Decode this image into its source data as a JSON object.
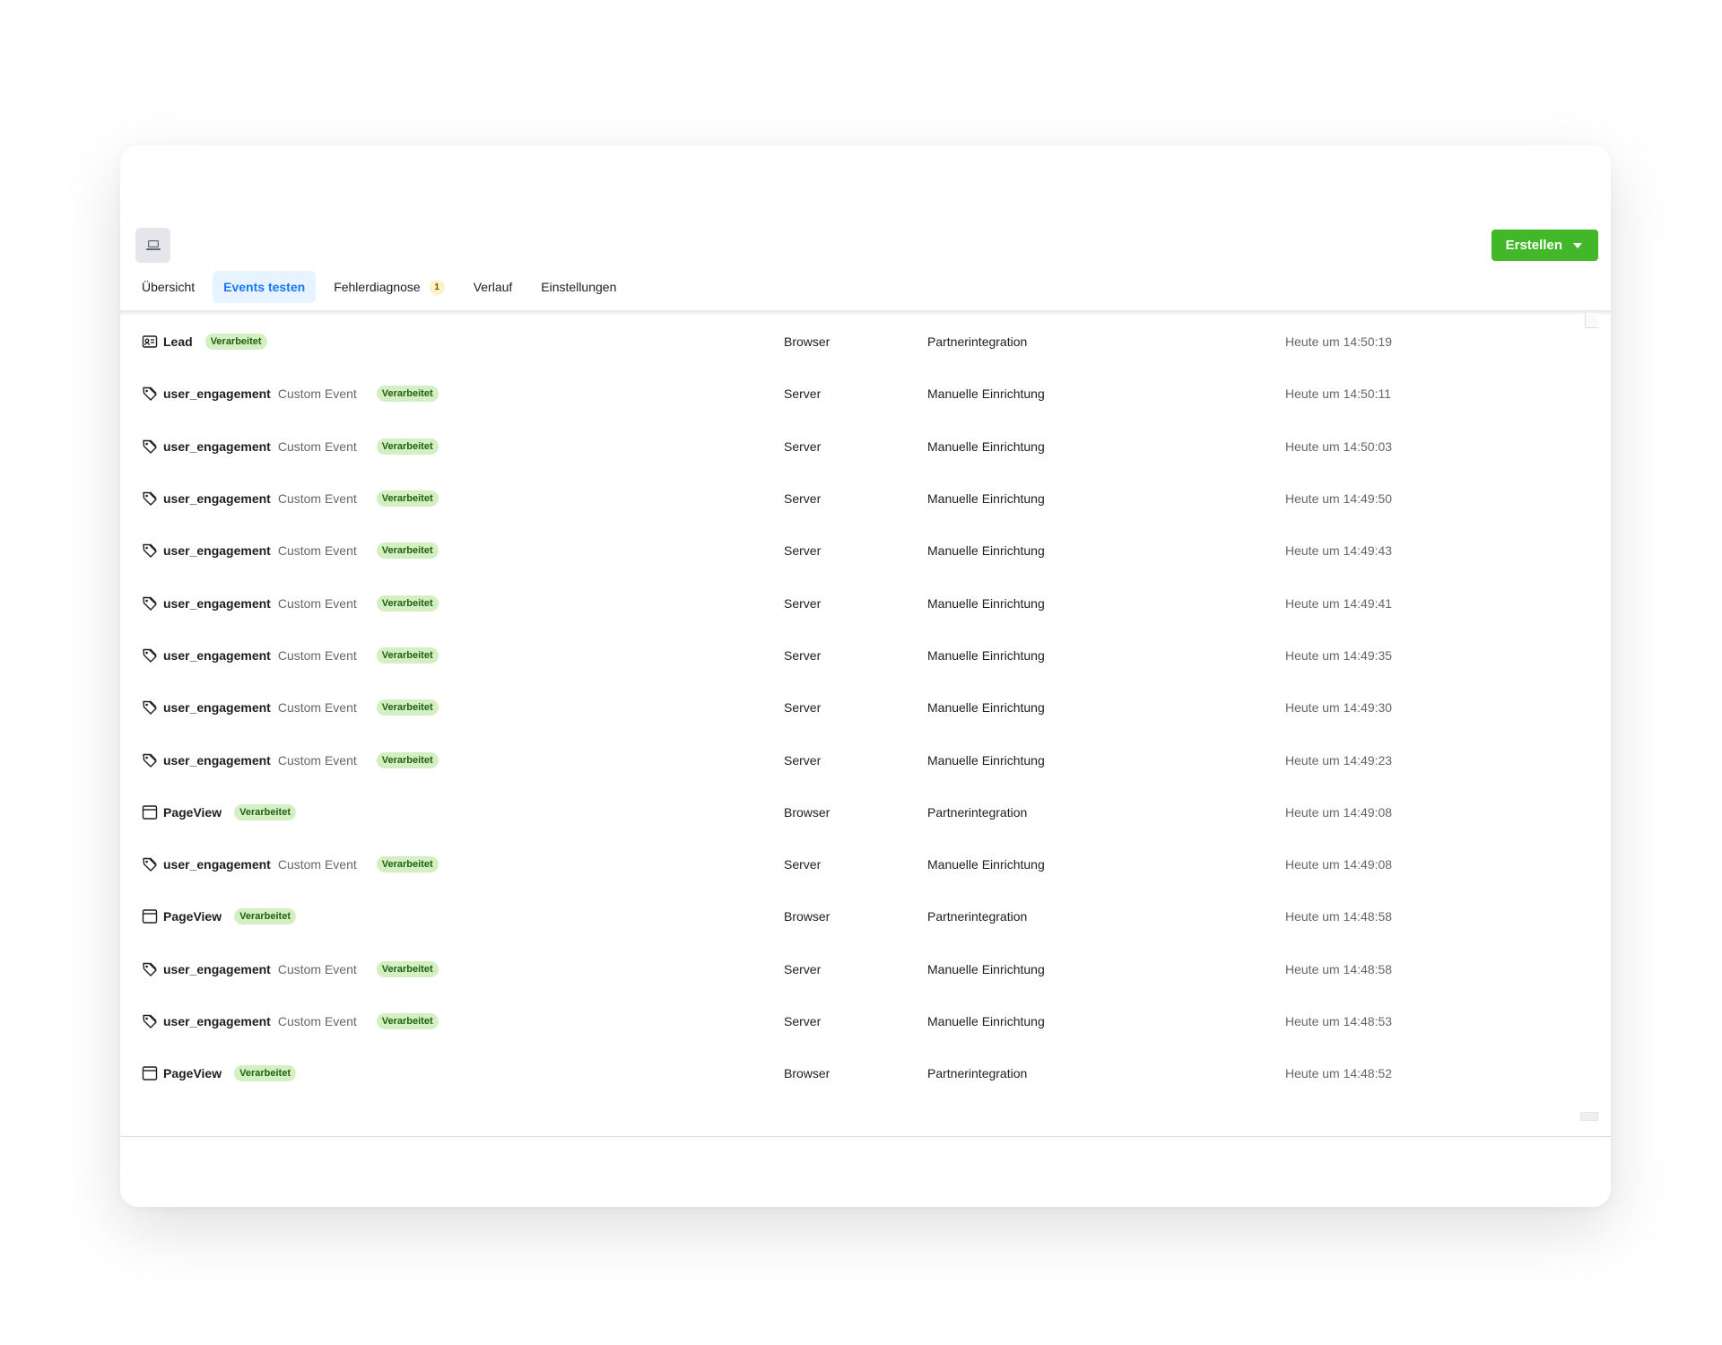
{
  "header": {
    "device_icon": "laptop-icon",
    "create_label": "Erstellen",
    "create_caret_icon": "caret-down-icon"
  },
  "tabs": [
    {
      "label": "Übersicht",
      "active": false
    },
    {
      "label": "Events testen",
      "active": true
    },
    {
      "label": "Fehlerdiagnose",
      "active": false,
      "count": "1"
    },
    {
      "label": "Verlauf",
      "active": false
    },
    {
      "label": "Einstellungen",
      "active": false
    }
  ],
  "colors": {
    "accent_blue": "#1877f2",
    "create_green": "#42b72a",
    "badge_bg": "#d4f0c2",
    "badge_text": "#1f5f12"
  },
  "events": [
    {
      "icon": "lead-card-icon",
      "name": "Lead",
      "type": "",
      "status": "Verarbeitet",
      "source": "Browser",
      "setup": "Partnerintegration",
      "time": "Heute um 14:50:19"
    },
    {
      "icon": "tag-icon",
      "name": "user_engagement",
      "type": "Custom Event",
      "status": "Verarbeitet",
      "source": "Server",
      "setup": "Manuelle Einrichtung",
      "time": "Heute um 14:50:11"
    },
    {
      "icon": "tag-icon",
      "name": "user_engagement",
      "type": "Custom Event",
      "status": "Verarbeitet",
      "source": "Server",
      "setup": "Manuelle Einrichtung",
      "time": "Heute um 14:50:03"
    },
    {
      "icon": "tag-icon",
      "name": "user_engagement",
      "type": "Custom Event",
      "status": "Verarbeitet",
      "source": "Server",
      "setup": "Manuelle Einrichtung",
      "time": "Heute um 14:49:50"
    },
    {
      "icon": "tag-icon",
      "name": "user_engagement",
      "type": "Custom Event",
      "status": "Verarbeitet",
      "source": "Server",
      "setup": "Manuelle Einrichtung",
      "time": "Heute um 14:49:43"
    },
    {
      "icon": "tag-icon",
      "name": "user_engagement",
      "type": "Custom Event",
      "status": "Verarbeitet",
      "source": "Server",
      "setup": "Manuelle Einrichtung",
      "time": "Heute um 14:49:41"
    },
    {
      "icon": "tag-icon",
      "name": "user_engagement",
      "type": "Custom Event",
      "status": "Verarbeitet",
      "source": "Server",
      "setup": "Manuelle Einrichtung",
      "time": "Heute um 14:49:35"
    },
    {
      "icon": "tag-icon",
      "name": "user_engagement",
      "type": "Custom Event",
      "status": "Verarbeitet",
      "source": "Server",
      "setup": "Manuelle Einrichtung",
      "time": "Heute um 14:49:30"
    },
    {
      "icon": "tag-icon",
      "name": "user_engagement",
      "type": "Custom Event",
      "status": "Verarbeitet",
      "source": "Server",
      "setup": "Manuelle Einrichtung",
      "time": "Heute um 14:49:23"
    },
    {
      "icon": "browser-window-icon",
      "name": "PageView",
      "type": "",
      "status": "Verarbeitet",
      "source": "Browser",
      "setup": "Partnerintegration",
      "time": "Heute um 14:49:08"
    },
    {
      "icon": "tag-icon",
      "name": "user_engagement",
      "type": "Custom Event",
      "status": "Verarbeitet",
      "source": "Server",
      "setup": "Manuelle Einrichtung",
      "time": "Heute um 14:49:08"
    },
    {
      "icon": "browser-window-icon",
      "name": "PageView",
      "type": "",
      "status": "Verarbeitet",
      "source": "Browser",
      "setup": "Partnerintegration",
      "time": "Heute um 14:48:58"
    },
    {
      "icon": "tag-icon",
      "name": "user_engagement",
      "type": "Custom Event",
      "status": "Verarbeitet",
      "source": "Server",
      "setup": "Manuelle Einrichtung",
      "time": "Heute um 14:48:58"
    },
    {
      "icon": "tag-icon",
      "name": "user_engagement",
      "type": "Custom Event",
      "status": "Verarbeitet",
      "source": "Server",
      "setup": "Manuelle Einrichtung",
      "time": "Heute um 14:48:53"
    },
    {
      "icon": "browser-window-icon",
      "name": "PageView",
      "type": "",
      "status": "Verarbeitet",
      "source": "Browser",
      "setup": "Partnerintegration",
      "time": "Heute um 14:48:52"
    }
  ]
}
